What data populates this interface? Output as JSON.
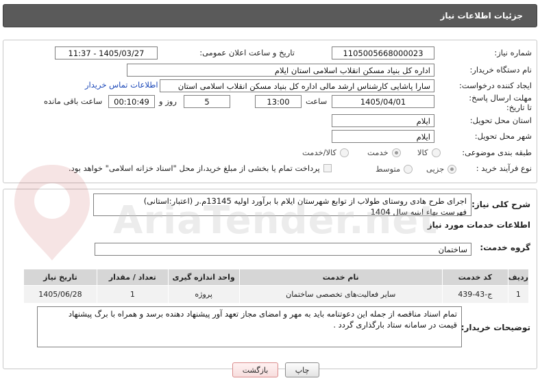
{
  "header": {
    "title": "جزئیات اطلاعات نیاز"
  },
  "form": {
    "need_number_label": "شماره نیاز:",
    "need_number": "1105005668000023",
    "announce_label": "تاریخ و ساعت اعلان عمومی:",
    "announce_value": "1405/03/27 - 11:37",
    "buyer_org_label": "نام دستگاه خریدار:",
    "buyer_org": "اداره کل بنیاد مسکن انقلاب اسلامی استان ایلام",
    "creator_label": "ایجاد کننده درخواست:",
    "creator": "سارا پاشایی کارشناس ارشد مالی اداره کل بنیاد مسکن انقلاب اسلامی استان",
    "contact_link": "اطلاعات تماس خریدار",
    "deadline_label": "مهلت ارسال پاسخ: تا تاریخ:",
    "deadline_date": "1405/04/01",
    "time_label": "ساعت",
    "deadline_time": "13:00",
    "days_value": "5",
    "days_label": "روز و",
    "remaining_time": "00:10:49",
    "remaining_label": "ساعت باقی مانده",
    "province_label": "استان محل تحویل:",
    "province": "ایلام",
    "city_label": "شهر محل تحویل:",
    "city": "ایلام",
    "category_label": "طبقه بندی موضوعی:",
    "category_options": [
      "کالا",
      "خدمت",
      "کالا/خدمت"
    ],
    "category_selected": "خدمت",
    "process_label": "نوع فرآیند خرید :",
    "process_options": [
      "جزیی",
      "متوسط"
    ],
    "process_selected": "جزیی",
    "payment_note": "پرداخت تمام یا بخشی از مبلغ خرید،از محل \"اسناد خزانه اسلامی\" خواهد بود."
  },
  "summary": {
    "label": "شرح کلی نیاز:",
    "line1": "اجرای طرح هادی روستای طولاب از توابع شهرستان ایلام با برآورد اولیه 13145م.ر (اعتبار:استانی)",
    "line2": "فهرست بهاء ابنیه سال 1404"
  },
  "services": {
    "section_title": "اطلاعات خدمات مورد نیاز",
    "group_label": "گروه خدمت:",
    "group_value": "ساختمان",
    "columns": [
      "ردیف",
      "کد خدمت",
      "نام خدمت",
      "واحد اندازه گیری",
      "تعداد / مقدار",
      "تاریخ نیاز"
    ],
    "rows": [
      [
        "1",
        "ج-43-439",
        "سایر فعالیت‌های تخصصی ساختمان",
        "پروژه",
        "1",
        "1405/06/28"
      ]
    ]
  },
  "buyer_notes": {
    "label": "توضیحات خریدار:",
    "line1": "تمام اسناد مناقصه از جمله این دعوتنامه باید به مهر و امضای مجاز تعهد آور پیشنهاد دهنده برسد و همراه با برگ پیشنهاد",
    "line2": "قیمت  در سامانه ستاد بارگذاری گردد ."
  },
  "buttons": {
    "print": "چاپ",
    "back": "بازگشت"
  },
  "watermark": {
    "brand": "AriaTender.net"
  }
}
